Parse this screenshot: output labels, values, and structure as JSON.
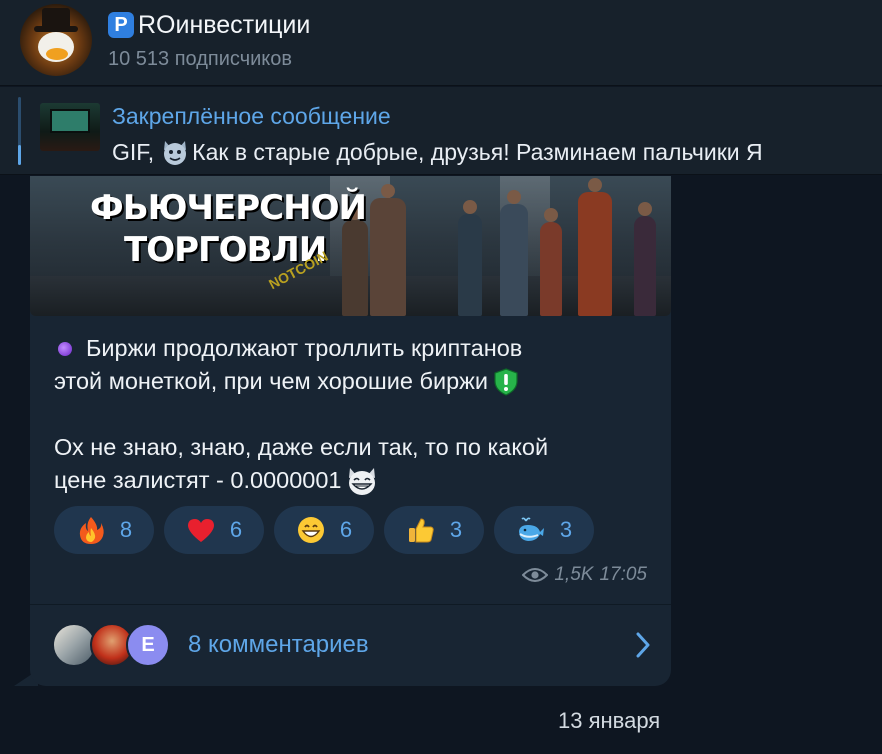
{
  "header": {
    "badge_letter": "P",
    "channel_name": "ROинвестиции",
    "subscribers": "10 513 подписчиков"
  },
  "pinned": {
    "title": "Закреплённое сообщение",
    "prefix": "GIF,",
    "text": "Как в старые добрые, друзья!  Разминаем пальчики Я"
  },
  "message": {
    "media": {
      "line1": "ФЬЮЧЕРСНОЙ",
      "line2": "ТОРГОВЛИ",
      "watermark": "NOTCOIN"
    },
    "lines": [
      "Биржи продолжают троллить криптанов",
      "этой монеткой, при чем хорошие биржи",
      "Ох не знаю, знаю, даже если так, то по какой",
      "цене залистят - 0.0000001"
    ],
    "reactions": [
      {
        "icon": "fire-icon",
        "count": "8"
      },
      {
        "icon": "heart-icon",
        "count": "6"
      },
      {
        "icon": "grinning-face-icon",
        "count": "6"
      },
      {
        "icon": "thumbs-up-icon",
        "count": "3"
      },
      {
        "icon": "whale-icon",
        "count": "3"
      }
    ],
    "views": "1,5K",
    "time": "17:05",
    "comments": {
      "avatar3_letter": "E",
      "label": "8 комментариев"
    }
  },
  "date_separator": "13 января",
  "colors": {
    "background": "#0e1621",
    "panel": "#17212b",
    "bubble": "#182533",
    "accent": "#5ea6e8",
    "reaction_pill": "#20364e"
  }
}
